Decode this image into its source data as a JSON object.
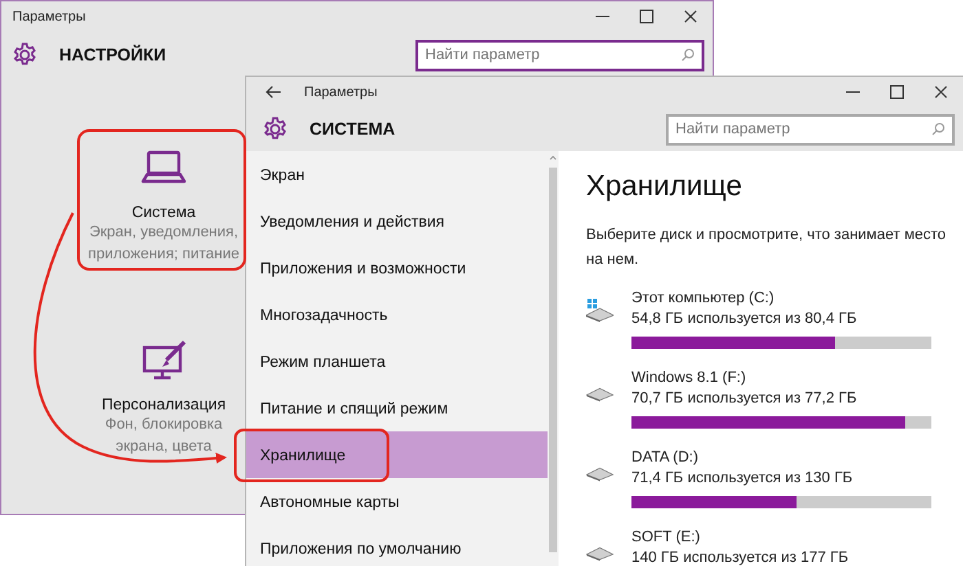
{
  "settings_window": {
    "title": "Параметры",
    "heading": "НАСТРОЙКИ",
    "search": {
      "placeholder": "Найти параметр",
      "focused": true
    },
    "tiles": [
      {
        "kind": "laptop",
        "title": "Система",
        "subtitle": [
          "Экран, уведомления,",
          "приложения; питание"
        ]
      },
      {
        "kind": "personalize",
        "title": "Персонализация",
        "subtitle": [
          "Фон, блокировка",
          "экрана, цвета"
        ]
      }
    ]
  },
  "system_window": {
    "title": "Параметры",
    "heading": "СИСТЕМА",
    "search": {
      "placeholder": "Найти параметр",
      "focused": false
    },
    "nav": [
      {
        "label": "Экран",
        "selected": false
      },
      {
        "label": "Уведомления и действия",
        "selected": false
      },
      {
        "label": "Приложения и возможности",
        "selected": false
      },
      {
        "label": "Многозадачность",
        "selected": false
      },
      {
        "label": "Режим планшета",
        "selected": false
      },
      {
        "label": "Питание и спящий режим",
        "selected": false
      },
      {
        "label": "Хранилище",
        "selected": true
      },
      {
        "label": "Автономные карты",
        "selected": false
      },
      {
        "label": "Приложения по умолчанию",
        "selected": false
      }
    ],
    "panel": {
      "title": "Хранилище",
      "description": "Выберите диск и просмотрите, что занимает место на нем.",
      "drives": [
        {
          "kind": "system",
          "name": "Этот компьютер (C:)",
          "usage": "54,8 ГБ используется из 80,4 ГБ",
          "level": 0.68
        },
        {
          "kind": "plain",
          "name": "Windows 8.1 (F:)",
          "usage": "70,7 ГБ используется из 77,2 ГБ",
          "level": 0.915
        },
        {
          "kind": "plain",
          "name": "DATA (D:)",
          "usage": "71,4 ГБ используется из 130 ГБ",
          "level": 0.55
        },
        {
          "kind": "plain",
          "name": "SOFT (E:)",
          "usage": "140 ГБ используется из 177 ГБ"
        }
      ]
    }
  }
}
